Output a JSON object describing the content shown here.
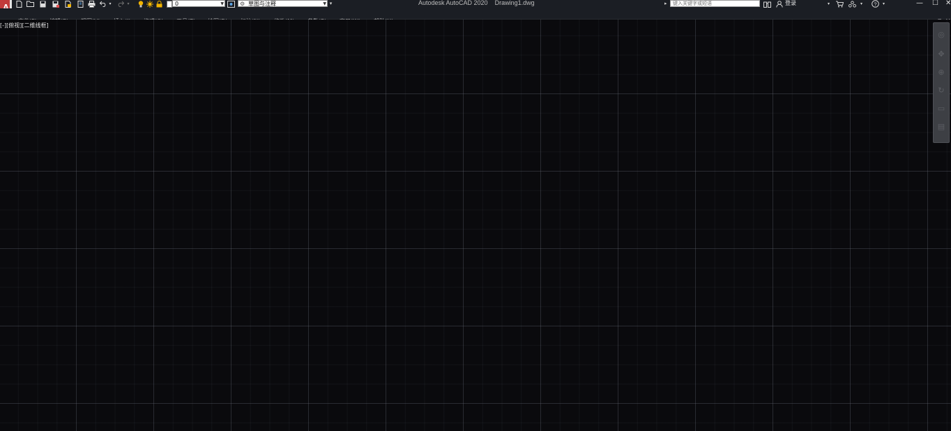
{
  "window": {
    "title": "Autodesk AutoCAD 2020    Drawing1.dwg",
    "app_button": "A"
  },
  "quick_access": {
    "layer_value": "0",
    "workspace_value": "草图与注释"
  },
  "search": {
    "placeholder": "键入关键字或短语"
  },
  "account": {
    "login_label": "登录"
  },
  "menu": {
    "items": [
      {
        "label": "文件(F)"
      },
      {
        "label": "编辑(E)"
      },
      {
        "label": "视图(V)"
      },
      {
        "label": "插入(I)"
      },
      {
        "label": "格式(O)"
      },
      {
        "label": "工具(T)"
      },
      {
        "label": "绘图(D)"
      },
      {
        "label": "标注(N)"
      },
      {
        "label": "修改(M)"
      },
      {
        "label": "参数(P)"
      },
      {
        "label": "窗口(W)"
      },
      {
        "label": "帮助(H)"
      }
    ]
  },
  "viewport": {
    "label": "[-][俯视][二维线框]"
  },
  "icons": {
    "new": "new-file-icon",
    "open": "open-folder-icon",
    "save": "save-icon",
    "save_as": "save-as-icon",
    "publish": "publish-icon",
    "plot": "print-icon",
    "undo": "undo-icon",
    "redo": "redo-icon",
    "layer_bulb": "lightbulb-icon",
    "layer_sun": "sun-icon",
    "layer_lock": "lock-icon",
    "workspace": "gear-icon",
    "binoculars": "binoculars-icon",
    "user": "user-icon",
    "cart": "cart-icon",
    "network": "network-icon",
    "help": "help-icon",
    "minimize": "minimize-icon",
    "maximize": "maximize-icon",
    "restore": "restore-icon",
    "close": "close-icon"
  },
  "colors": {
    "canvas_bg": "#0a0a0d",
    "toolbar_bg": "#1b1e24",
    "app_button": "#c23b3b",
    "layer_icons": "#f2b400"
  }
}
